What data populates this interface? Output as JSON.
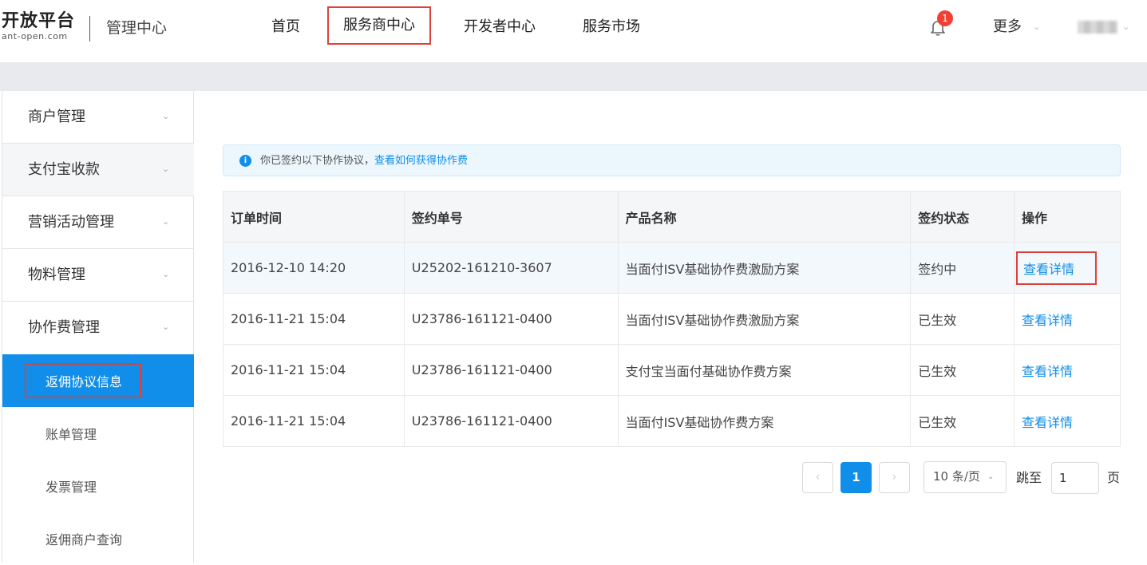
{
  "header": {
    "logo_main": "开放平台",
    "logo_sub": "ant-open.com",
    "title": "管理中心",
    "nav": [
      "首页",
      "服务商中心",
      "开发者中心",
      "服务市场"
    ],
    "badge_count": "1",
    "more_label": "更多",
    "bell_icon": "bell-icon"
  },
  "sidebar": {
    "groups": [
      "商户管理",
      "支付宝收款",
      "营销活动管理",
      "物料管理",
      "协作费管理"
    ],
    "subitems": [
      "返佣协议信息",
      "账单管理",
      "发票管理",
      "返佣商户查询"
    ]
  },
  "alert": {
    "text": "你已签约以下协作协议，",
    "link": "查看如何获得协作费",
    "icon": "info-icon"
  },
  "table": {
    "headers": [
      "订单时间",
      "签约单号",
      "产品名称",
      "签约状态",
      "操作"
    ],
    "rows": [
      [
        "2016-12-10 14:20",
        "U25202-161210-3607",
        "当面付ISV基础协作费激励方案",
        "签约中",
        "查看详情"
      ],
      [
        "2016-11-21 15:04",
        "U23786-161121-0400",
        "当面付ISV基础协作费激励方案",
        "已生效",
        "查看详情"
      ],
      [
        "2016-11-21 15:04",
        "U23786-161121-0400",
        "支付宝当面付基础协作费方案",
        "已生效",
        "查看详情"
      ],
      [
        "2016-11-21 15:04",
        "U23786-161121-0400",
        "当面付ISV基础协作费方案",
        "已生效",
        "查看详情"
      ]
    ]
  },
  "pagination": {
    "current": "1",
    "page_size": "10 条/页",
    "jump_label": "跳至",
    "jump_value": "1",
    "page_suffix": "页"
  },
  "colors": {
    "primary": "#108ee9",
    "highlight_box": "#e0403a",
    "badge": "#f04134"
  }
}
